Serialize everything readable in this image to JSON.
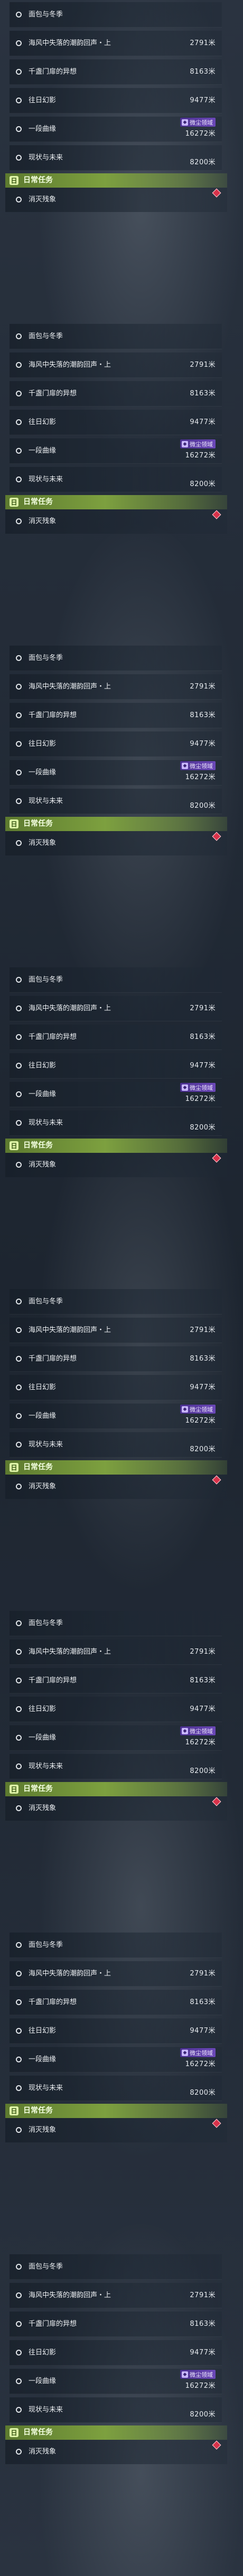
{
  "quests": [
    {
      "title": "面包与冬季",
      "distance": null,
      "badge": null
    },
    {
      "title": "海风中失落的潮韵回声・上",
      "distance": "2791米",
      "badge": null
    },
    {
      "title": "千盏门扉的异想",
      "distance": "8163米",
      "badge": null
    },
    {
      "title": "往日幻影",
      "distance": "9477米",
      "badge": null
    },
    {
      "title": "一段曲缘",
      "distance": "16272米",
      "badge": "微尘领域"
    },
    {
      "title": "现状与未来",
      "distance": "8200米",
      "badge": null
    }
  ],
  "daily": {
    "header": "日常任务",
    "quest_title": "消灭残象"
  },
  "icons": {
    "quest_marker": "circle-outline",
    "badge_icon": "domain-icon",
    "daily_icon": "daily-icon",
    "alert": "red-diamond"
  },
  "colors": {
    "daily_bar": "#7da03f",
    "badge": "#6b48b8",
    "alert": "#d8324a"
  }
}
